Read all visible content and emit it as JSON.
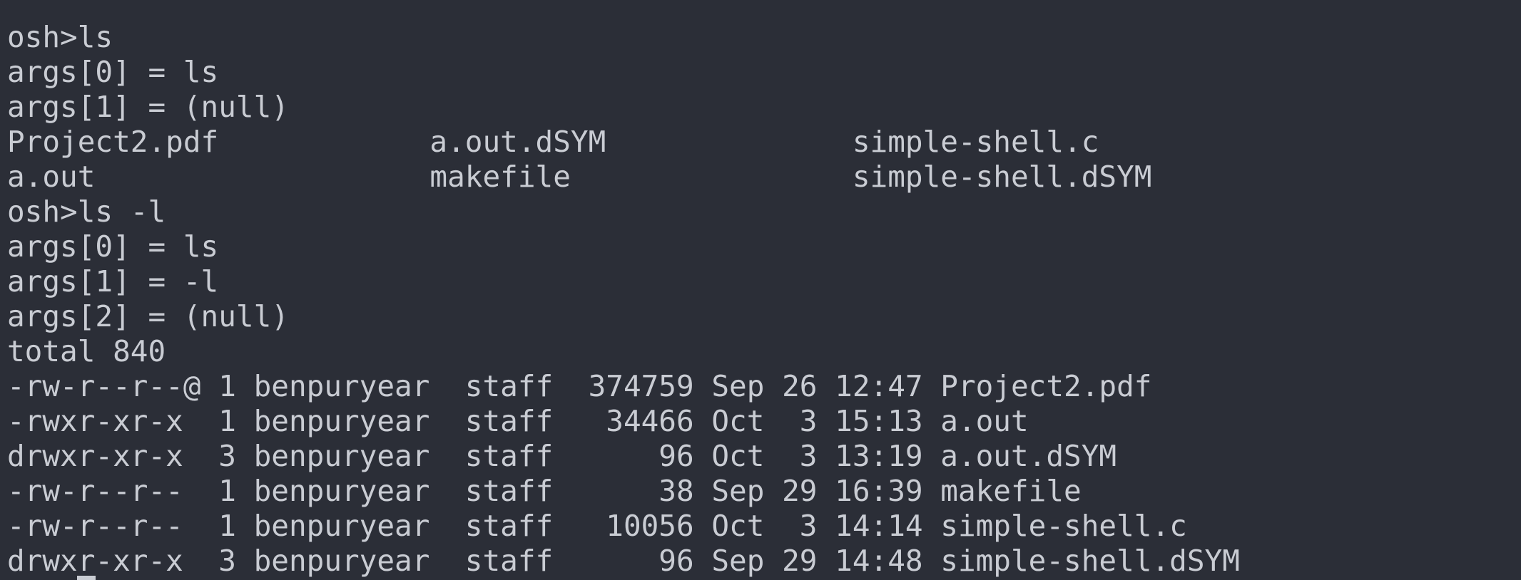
{
  "terminal": {
    "lines": [
      "osh>ls",
      "args[0] = ls",
      "args[1] = (null)",
      "Project2.pdf            a.out.dSYM              simple-shell.c",
      "a.out                   makefile                simple-shell.dSYM",
      "osh>ls -l",
      "args[0] = ls",
      "args[1] = -l",
      "args[2] = (null)",
      "total 840",
      "-rw-r--r--@ 1 benpuryear  staff  374759 Sep 26 12:47 Project2.pdf",
      "-rwxr-xr-x  1 benpuryear  staff   34466 Oct  3 15:13 a.out",
      "drwxr-xr-x  3 benpuryear  staff      96 Oct  3 13:19 a.out.dSYM",
      "-rw-r--r--  1 benpuryear  staff      38 Sep 29 16:39 makefile",
      "-rw-r--r--  1 benpuryear  staff   10056 Oct  3 14:14 simple-shell.c",
      "drwxr-xr-x  3 benpuryear  staff      96 Sep 29 14:48 simple-shell.dSYM"
    ]
  },
  "colors": {
    "background": "#2b2e37",
    "text": "#c9ccd3"
  }
}
